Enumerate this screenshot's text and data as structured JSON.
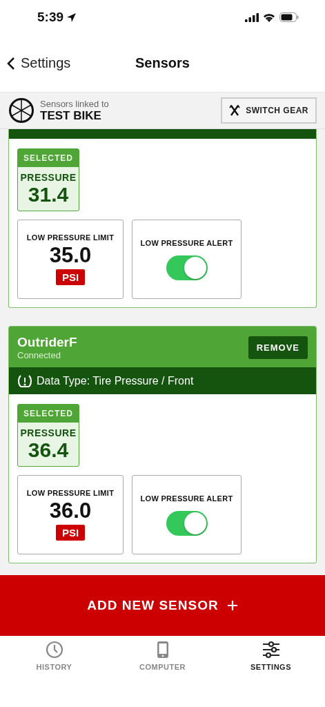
{
  "status_bar": {
    "time": "5:39"
  },
  "nav": {
    "back": "Settings",
    "title": "Sensors"
  },
  "gear_header": {
    "caption": "Sensors linked to",
    "bike": "TEST BIKE",
    "button": "SWITCH GEAR"
  },
  "sensors": [
    {
      "kind": "cut",
      "selected": true,
      "selected_badge": "SELECTED",
      "reading_label": "PRESSURE",
      "reading": "31.4",
      "limit_label": "LOW PRESSURE LIMIT",
      "limit": "35.0",
      "unit": "PSI",
      "alert_label": "LOW PRESSURE ALERT",
      "alert_on": true
    },
    {
      "kind": "full",
      "name": "OutriderF",
      "status": "Connected",
      "remove": "REMOVE",
      "data_type": "Data Type: Tire Pressure / Front",
      "selected": true,
      "selected_badge": "SELECTED",
      "reading_label": "PRESSURE",
      "reading": "36.4",
      "limit_label": "LOW PRESSURE LIMIT",
      "limit": "36.0",
      "unit": "PSI",
      "alert_label": "LOW PRESSURE ALERT",
      "alert_on": true
    }
  ],
  "add_button": {
    "label": "ADD NEW SENSOR"
  },
  "tabs": [
    {
      "label": "HISTORY",
      "selected": false
    },
    {
      "label": "COMPUTER",
      "selected": false
    },
    {
      "label": "SETTINGS",
      "selected": true
    }
  ]
}
